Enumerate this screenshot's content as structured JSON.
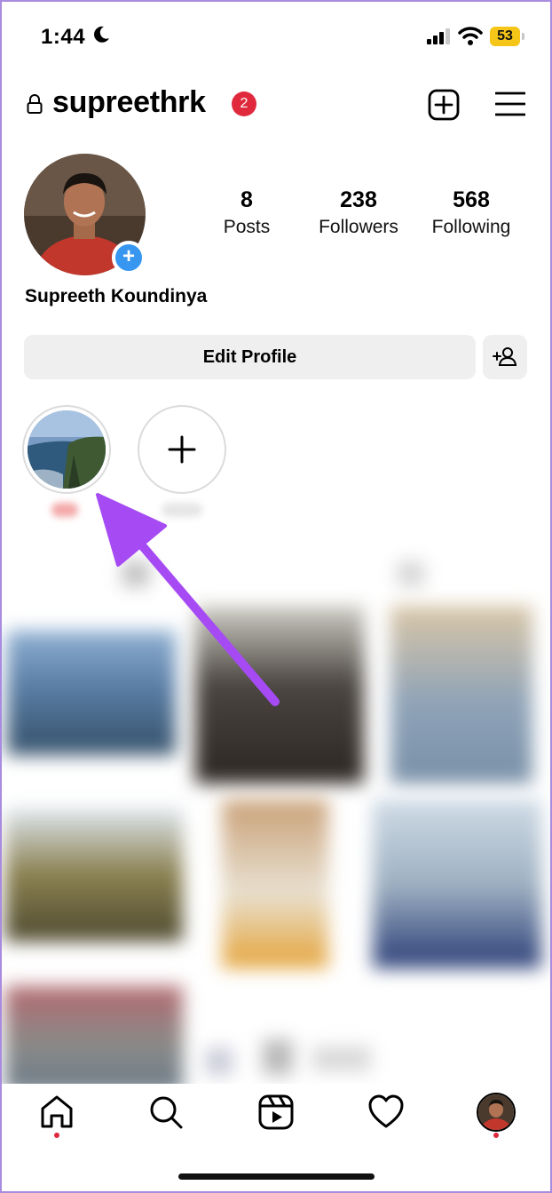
{
  "status_bar": {
    "time": "1:44",
    "battery": "53"
  },
  "header": {
    "username": "supreethrk",
    "notification_count": "2"
  },
  "profile": {
    "name": "Supreeth Koundinya",
    "stats": [
      {
        "value": "8",
        "label": "Posts"
      },
      {
        "value": "238",
        "label": "Followers"
      },
      {
        "value": "568",
        "label": "Following"
      }
    ]
  },
  "actions": {
    "edit_profile": "Edit Profile"
  },
  "highlights": [
    {
      "icon": "coastline-photo"
    },
    {
      "icon": "plus-icon"
    }
  ],
  "tab_bar": [
    "home-icon",
    "search-icon",
    "reels-icon",
    "heart-icon",
    "profile-avatar"
  ],
  "colors": {
    "badge_red": "#e0293d",
    "add_blue": "#3797f0",
    "battery_yellow": "#f5c518",
    "arrow_purple": "#a64bf4"
  }
}
